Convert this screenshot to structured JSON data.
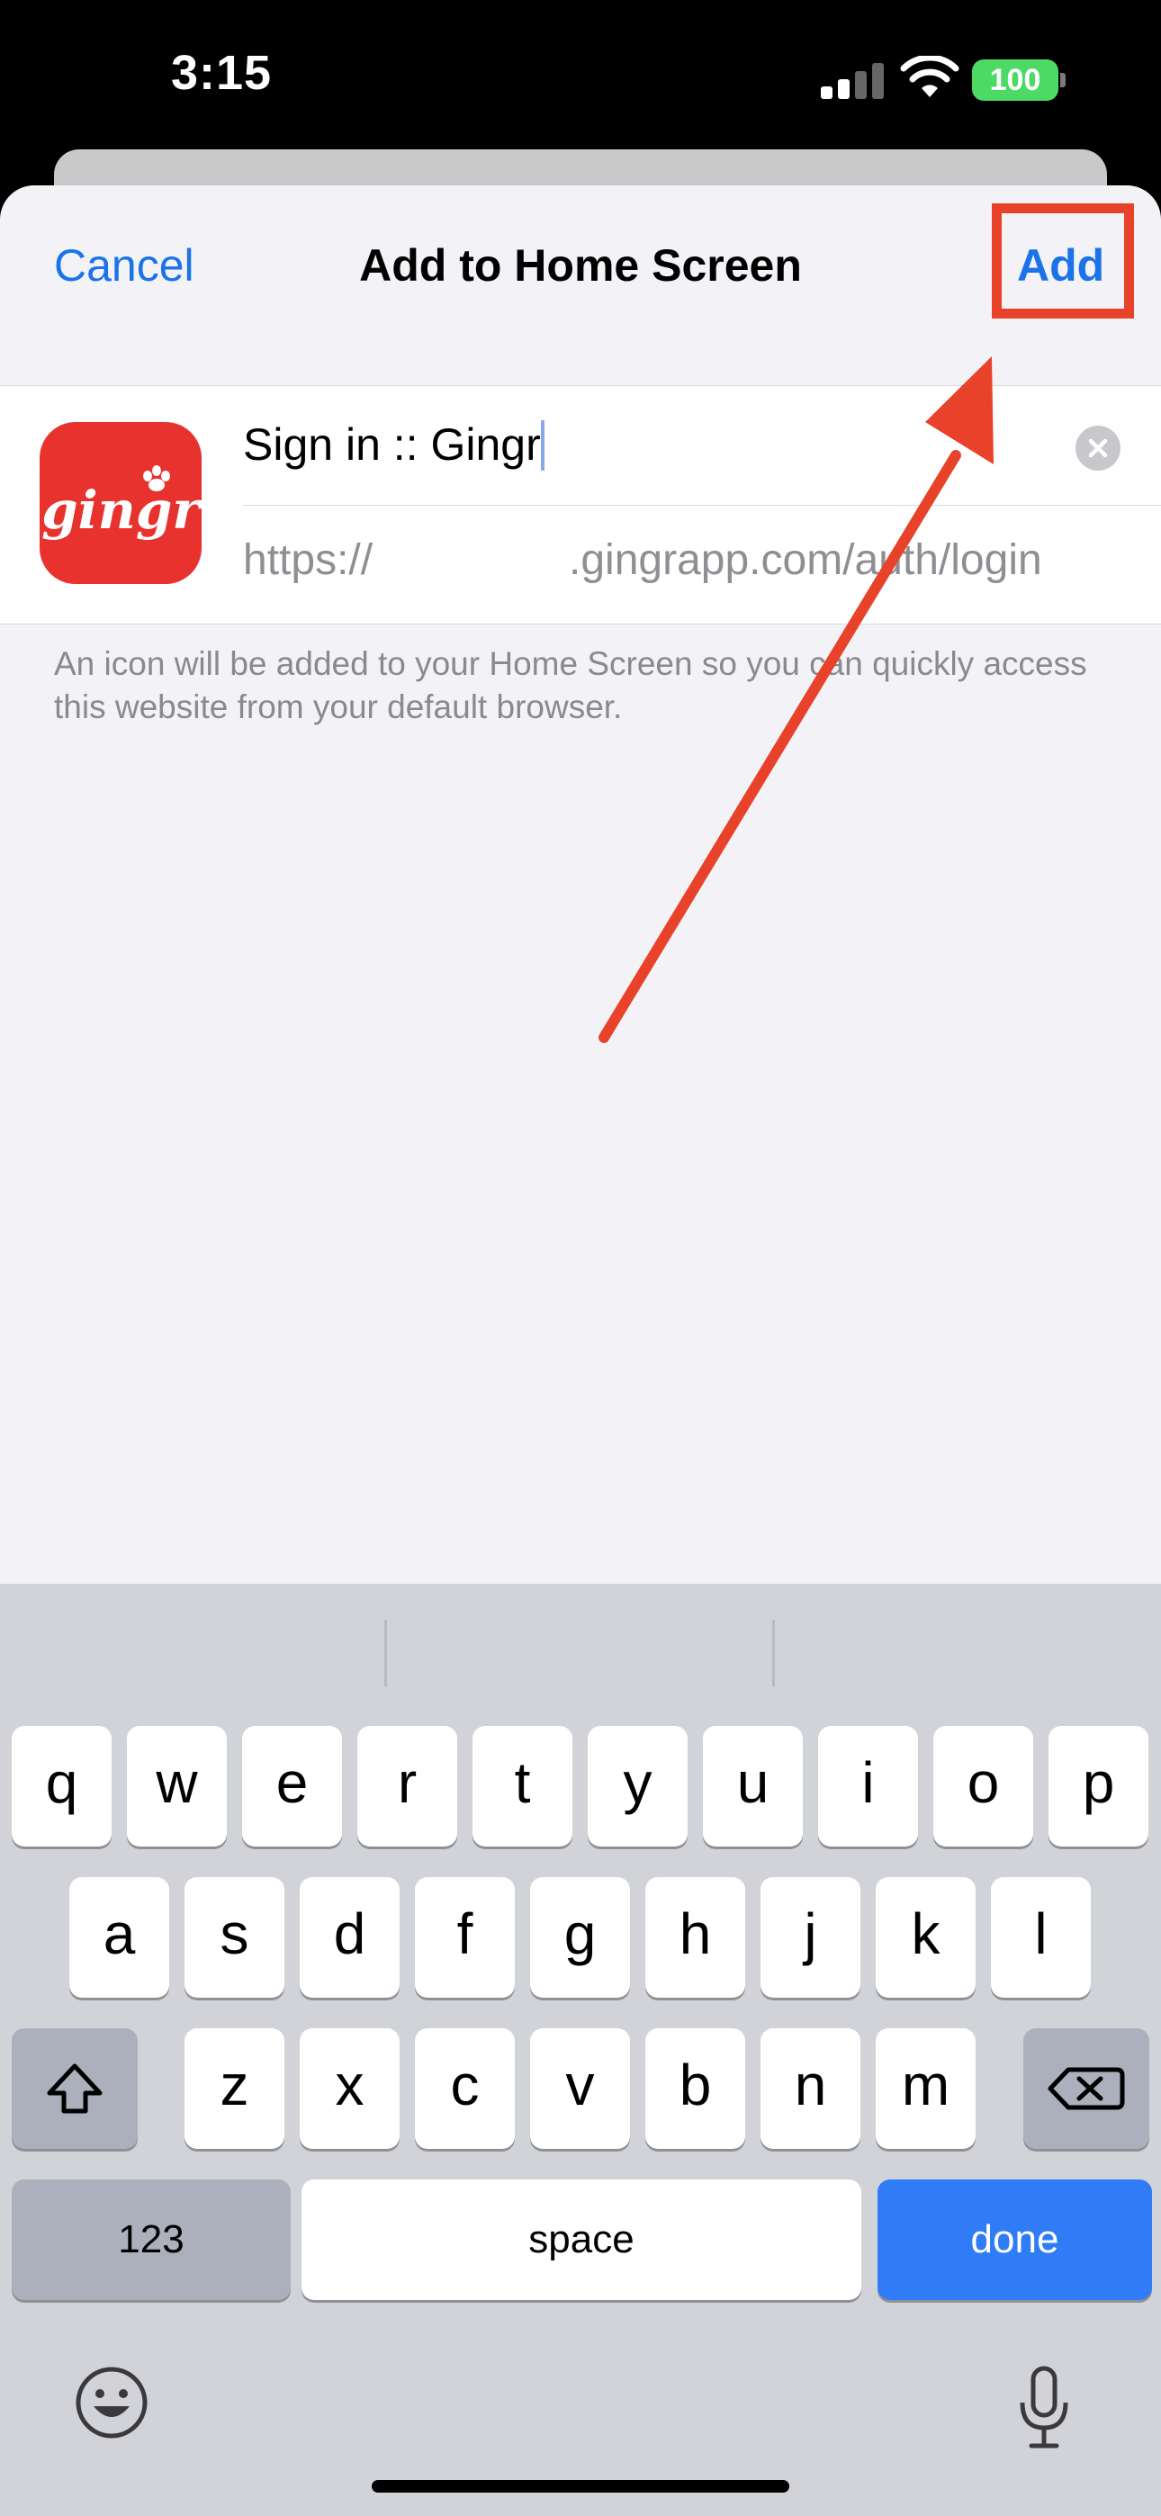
{
  "status_bar": {
    "time": "3:15",
    "battery": "100",
    "signal_icon": "cellular-signal-icon",
    "wifi_icon": "wifi-icon"
  },
  "nav": {
    "cancel": "Cancel",
    "title": "Add to Home Screen",
    "add": "Add"
  },
  "form": {
    "app_icon_label": "gingr",
    "name_value": "Sign in :: Gingr",
    "url_prefix": "https://",
    "url_host": ".gingrapp.com/auth/login"
  },
  "footnote": "An icon will be added to your Home Screen so you can quickly access this website from your default browser.",
  "annotation": {
    "color": "#e8432a",
    "target": "Add"
  },
  "keyboard": {
    "row1": [
      "q",
      "w",
      "e",
      "r",
      "t",
      "y",
      "u",
      "i",
      "o",
      "p"
    ],
    "row2": [
      "a",
      "s",
      "d",
      "f",
      "g",
      "h",
      "j",
      "k",
      "l"
    ],
    "row3": [
      "z",
      "x",
      "c",
      "v",
      "b",
      "n",
      "m"
    ],
    "numbers": "123",
    "space": "space",
    "done": "done"
  },
  "colors": {
    "accent": "#1a73e8",
    "done_key": "#2f7cf6",
    "icon_bg": "#e8322e",
    "battery": "#4cd964"
  }
}
